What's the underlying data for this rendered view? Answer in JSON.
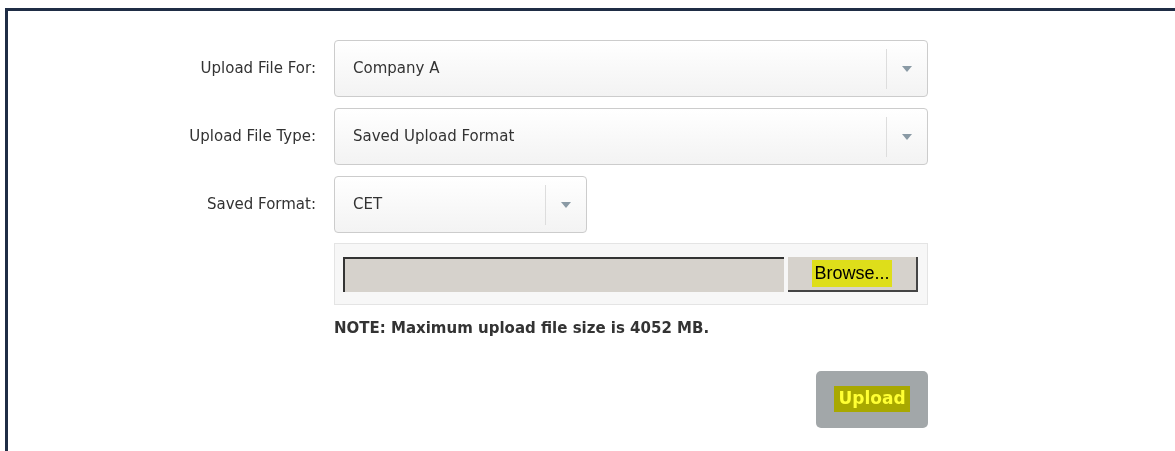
{
  "fields": [
    {
      "label": "Upload File For:",
      "value": "Company A",
      "kind": "wide"
    },
    {
      "label": "Upload File Type:",
      "value": "Saved Upload Format",
      "kind": "wide"
    },
    {
      "label": "Saved Format:",
      "value": "CET",
      "kind": "narrow"
    }
  ],
  "file_picker": {
    "button": "Browse...",
    "highlighted": true
  },
  "note": "NOTE: Maximum upload file size is 4052 MB.",
  "upload_button": {
    "label": "Upload",
    "highlighted": true
  }
}
